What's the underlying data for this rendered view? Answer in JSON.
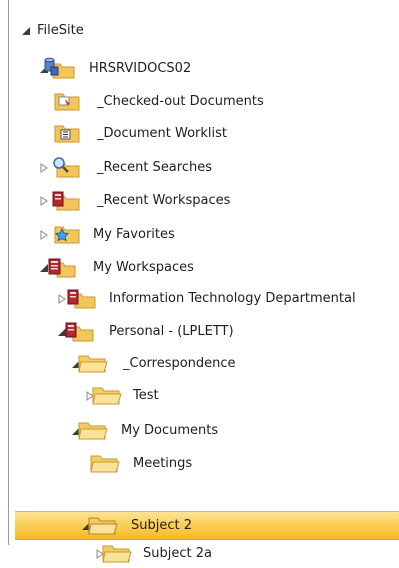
{
  "tree": {
    "root_label": "FileSite",
    "items": [
      {
        "label": "HRSRVIDOCS02",
        "icon": "server-folder-icon"
      },
      {
        "label": "_Checked-out Documents",
        "icon": "checked-out-folder-icon"
      },
      {
        "label": "_Document Worklist",
        "icon": "worklist-folder-icon"
      },
      {
        "label": "_Recent Searches",
        "icon": "search-folder-icon"
      },
      {
        "label": "_Recent Workspaces",
        "icon": "workspace-folder-icon"
      },
      {
        "label": "My Favorites",
        "icon": "favorites-folder-icon"
      },
      {
        "label": "My Workspaces",
        "icon": "workspace-folder-icon"
      },
      {
        "label": "Information Technology Departmental",
        "icon": "workspace-folder-icon"
      },
      {
        "label": "Personal - (LPLETT)",
        "icon": "workspace-folder-icon"
      },
      {
        "label": "_Correspondence",
        "icon": "folder-icon"
      },
      {
        "label": "Test",
        "icon": "folder-icon"
      },
      {
        "label": "My Documents",
        "icon": "folder-icon"
      },
      {
        "label": "Meetings",
        "icon": "folder-icon"
      },
      {
        "label": "Subject 2",
        "icon": "folder-icon"
      },
      {
        "label": "Subject 2a",
        "icon": "folder-icon"
      }
    ],
    "selected_label": "Subject 2"
  },
  "colors": {
    "selection": "#fbd05a",
    "folder": "#f2c65a",
    "workspace": "#b3262f",
    "server": "#5a7fc4"
  }
}
